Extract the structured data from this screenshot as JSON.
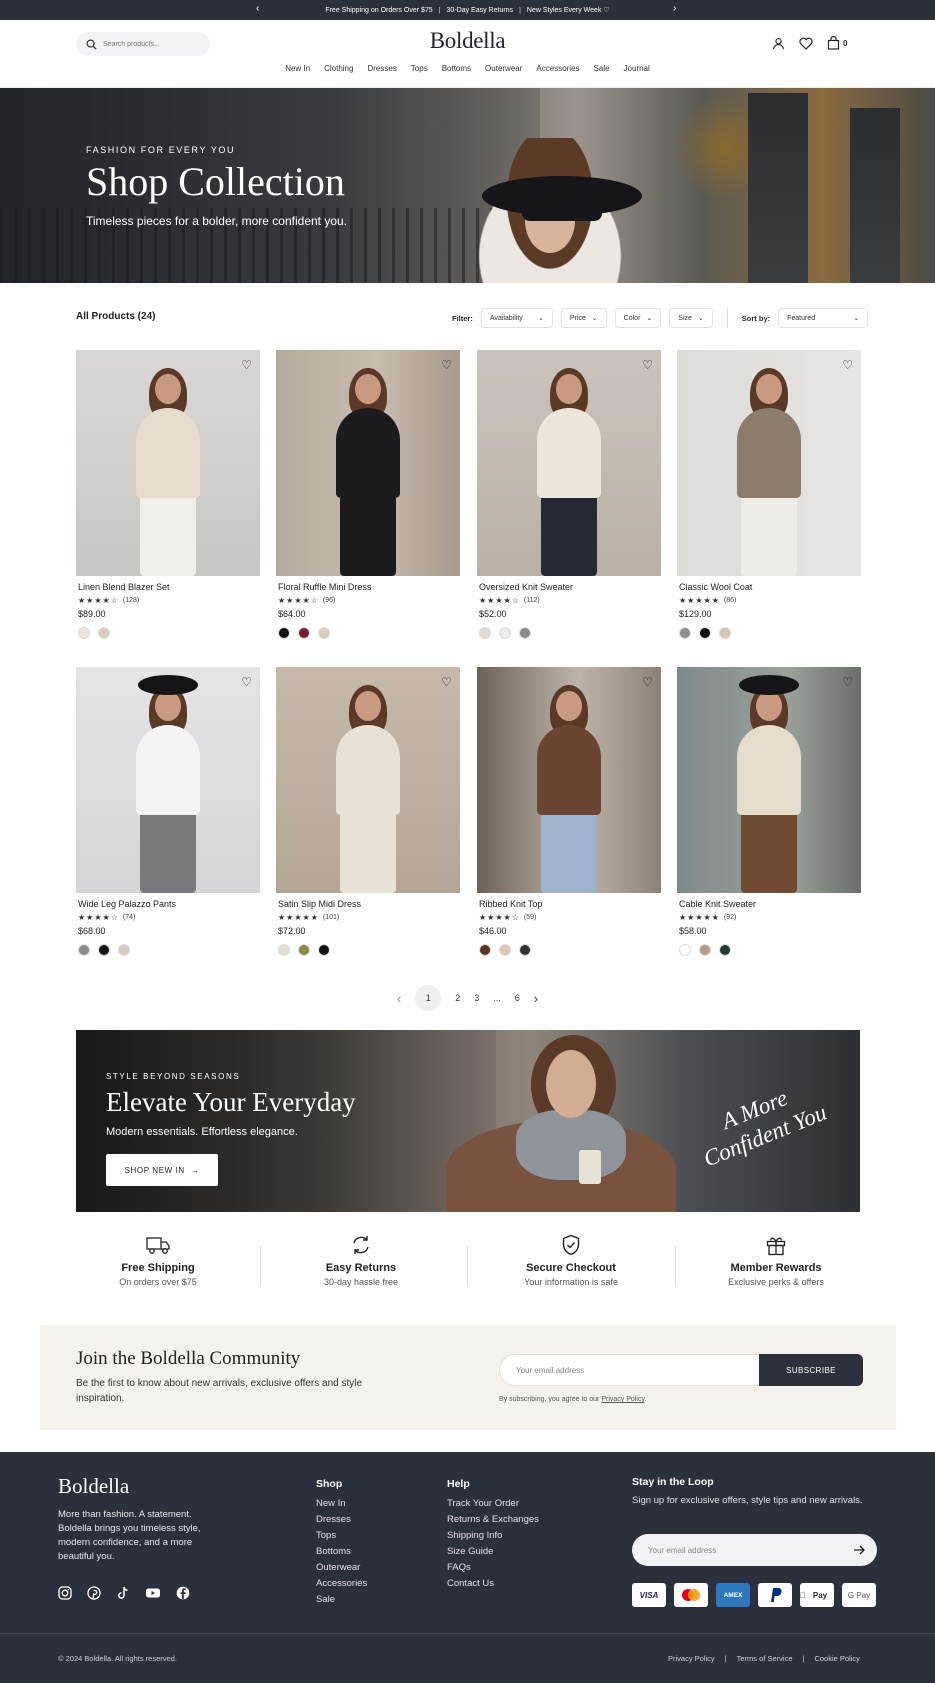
{
  "announcement": {
    "items": [
      "Free Shipping on Orders Over $75",
      "30-Day Easy Returns",
      "New Styles Every Week ♡"
    ],
    "sep": "|",
    "prev": "‹",
    "next": "›"
  },
  "header": {
    "search_placeholder": "Search products...",
    "logo": "Boldella",
    "cart_count": "0"
  },
  "nav": [
    "New In",
    "Clothing",
    "Dresses",
    "Tops",
    "Bottoms",
    "Outerwear",
    "Accessories",
    "Sale",
    "Journal"
  ],
  "hero": {
    "eyebrow": "FASHION FOR EVERY YOU",
    "title": "Shop Collection",
    "subtitle": "Timeless pieces for a bolder, more confident you."
  },
  "filters": {
    "count_label": "All Products (24)",
    "filter_label": "Filter:",
    "chips": [
      "Availability",
      "Price",
      "Color",
      "Size"
    ],
    "sort_label": "Sort by:",
    "sort_value": "Featured"
  },
  "products": [
    {
      "name": "Linen Blend Blazer Set",
      "stars": "★★★★☆",
      "reviews": "(128)",
      "price": "$89.00",
      "swatches": [
        "#ebe5dc",
        "#d6cbbd"
      ]
    },
    {
      "name": "Floral Ruffle Mini Dress",
      "stars": "★★★★☆",
      "reviews": "(96)",
      "price": "$64.00",
      "swatches": [
        "#111111",
        "#7a1d33",
        "#d9cbb7"
      ]
    },
    {
      "name": "Oversized Knit Sweater",
      "stars": "★★★★☆",
      "reviews": "(112)",
      "price": "$52.00",
      "swatches": [
        "#e2d8cb",
        "#ecebe8",
        "#8a8a8a"
      ]
    },
    {
      "name": "Classic Wool Coat",
      "stars": "★★★★★",
      "reviews": "(86)",
      "price": "$129.00",
      "swatches": [
        "#8f8f8f",
        "#111111",
        "#d5c6b2"
      ]
    },
    {
      "name": "Wide Leg Palazzo Pants",
      "stars": "★★★★☆",
      "reviews": "(74)",
      "price": "$68.00",
      "swatches": [
        "#8c8c8c",
        "#111111",
        "#d6cbbd"
      ]
    },
    {
      "name": "Satin Slip Midi Dress",
      "stars": "★★★★★",
      "reviews": "(101)",
      "price": "$72.00",
      "swatches": [
        "#e2ddd0",
        "#8c8a45",
        "#111111"
      ]
    },
    {
      "name": "Ribbed Knit Top",
      "stars": "★★★★☆",
      "reviews": "(59)",
      "price": "$46.00",
      "swatches": [
        "#5a3423",
        "#d8c8b7",
        "#333333"
      ]
    },
    {
      "name": "Cable Knit Sweater",
      "stars": "★★★★★",
      "reviews": "(92)",
      "price": "$58.00",
      "swatches": [
        "#ffffff",
        "#b39c85",
        "#253a2f"
      ]
    }
  ],
  "pagination": {
    "prev": "‹",
    "pages": [
      "1",
      "2",
      "3",
      "...",
      "6"
    ],
    "next": "›"
  },
  "promo": {
    "eyebrow": "STYLE BEYOND SEASONS",
    "title": "Elevate Your Everyday",
    "subtitle": "Modern essentials. Effortless elegance.",
    "button": "SHOP NEW IN",
    "script": "A More Confident You"
  },
  "features": [
    {
      "title": "Free Shipping",
      "sub": "On orders over $75",
      "icon": "truck-icon"
    },
    {
      "title": "Easy Returns",
      "sub": "30-day hassle free",
      "icon": "refresh-icon"
    },
    {
      "title": "Secure Checkout",
      "sub": "Your information is safe",
      "icon": "shield-icon"
    },
    {
      "title": "Member Rewards",
      "sub": "Exclusive perks & offers",
      "icon": "gift-icon"
    }
  ],
  "community": {
    "title": "Join the Boldella Community",
    "text": "Be the first to know about new arrivals, exclusive offers and style inspiration.",
    "placeholder": "Your email address",
    "button": "SUBSCRIBE",
    "note_pre": "By subscribing, you agree to our ",
    "note_link": "Privacy Policy",
    "note_post": "."
  },
  "footer": {
    "logo": "Boldella",
    "desc": "More than fashion. A statement. Boldella brings you timeless style, modern confidence, and a more beautiful you.",
    "shop": {
      "heading": "Shop",
      "links": [
        "New In",
        "Dresses",
        "Tops",
        "Bottoms",
        "Outerwear",
        "Accessories",
        "Sale"
      ]
    },
    "help": {
      "heading": "Help",
      "links": [
        "Track Your Order",
        "Returns & Exchanges",
        "Shipping Info",
        "Size Guide",
        "FAQs",
        "Contact Us"
      ]
    },
    "loop": {
      "heading": "Stay in the Loop",
      "text": "Sign up for exclusive offers, style tips and new arrivals.",
      "placeholder": "Your email address"
    },
    "payments": [
      "VISA",
      "MC",
      "AMEX",
      "PayPal",
      "Pay",
      "G Pay"
    ],
    "copyright": "© 2024 Boldella. All rights reserved.",
    "legal": [
      "Privacy Policy",
      "Terms of Service",
      "Cookie Policy"
    ],
    "legal_sep": "|"
  }
}
